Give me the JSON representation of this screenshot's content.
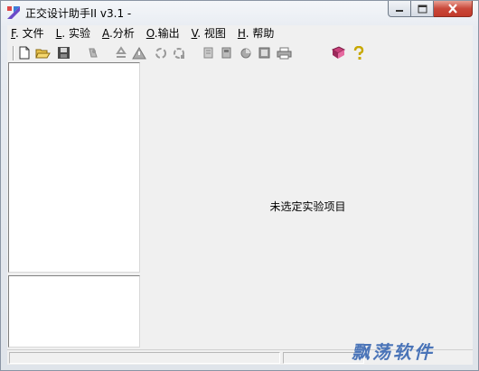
{
  "window": {
    "title": "正交设计助手II v3.1 -"
  },
  "menu": {
    "items": [
      {
        "mnemonic": "F",
        "label": ". 文件"
      },
      {
        "mnemonic": "L",
        "label": ". 实验"
      },
      {
        "mnemonic": "A",
        "label": ".分析"
      },
      {
        "mnemonic": "O",
        "label": ".输出"
      },
      {
        "mnemonic": "V",
        "label": ". 视图"
      },
      {
        "mnemonic": "H",
        "label": ". 帮助"
      }
    ]
  },
  "toolbar": {
    "icons": [
      "new-file-icon",
      "open-folder-icon",
      "save-icon",
      "experiment-icon",
      "recycle-icon",
      "warning-icon",
      "recycle-2-icon",
      "recycle-3-icon",
      "report-icon",
      "table-icon",
      "chart-icon",
      "document-icon",
      "print-icon",
      "book-icon",
      "help-icon"
    ]
  },
  "main": {
    "empty_message": "未选定实验项目"
  },
  "watermark": {
    "text": "飘荡软件"
  },
  "colors": {
    "accent_close": "#c9483a",
    "watermark": "#4a74b8"
  }
}
